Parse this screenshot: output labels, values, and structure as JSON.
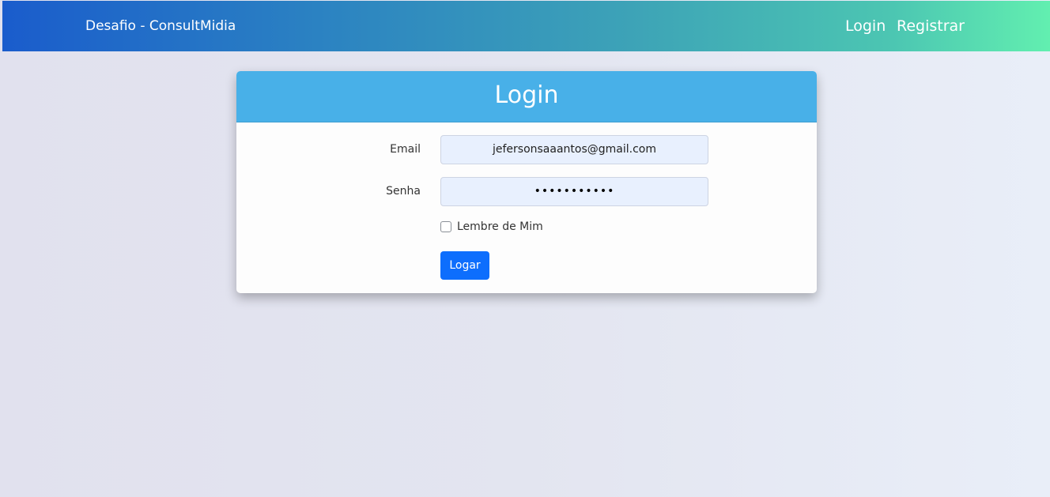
{
  "navbar": {
    "brand": "Desafio - ConsultMidia",
    "links": [
      "Login",
      "Registrar"
    ]
  },
  "card": {
    "title": "Login",
    "email_label": "Email",
    "email_value": "jefersonsaaantos@gmail.com",
    "password_label": "Senha",
    "password_value": "•••••••••••",
    "remember_label": "Lembre de Mim",
    "remember_checked": false,
    "submit_label": "Logar"
  },
  "colors": {
    "header": "#48b0e8",
    "button": "#0d6efd",
    "input_bg": "#e8f0fe"
  }
}
